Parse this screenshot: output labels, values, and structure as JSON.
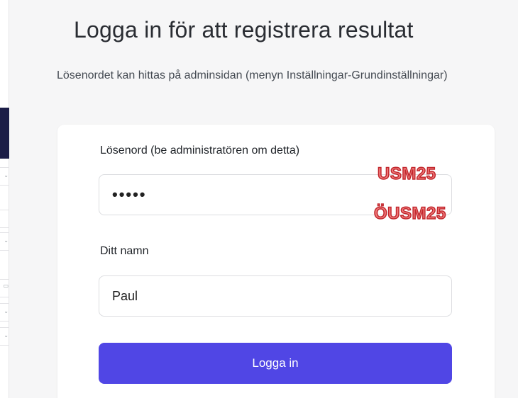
{
  "page": {
    "title": "Logga in för att registrera resultat",
    "description": "Lösenordet kan hittas på adminsidan (menyn Inställningar-Grundinställningar)"
  },
  "form": {
    "password_label": "Lösenord (be administratören om detta)",
    "password_value": "•••••",
    "name_label": "Ditt namn",
    "name_value": "Paul",
    "submit_label": "Logga in"
  },
  "annotations": {
    "line1": "USM25",
    "line2": "ÖUSM25"
  },
  "left_strip": {
    "chevron_icon": "chevron-down-icon",
    "calendar_icon": "calendar-icon"
  },
  "colors": {
    "accent": "#5046e5",
    "sidebar_dark": "#1b1d47",
    "annotation_red": "#c2272d"
  }
}
